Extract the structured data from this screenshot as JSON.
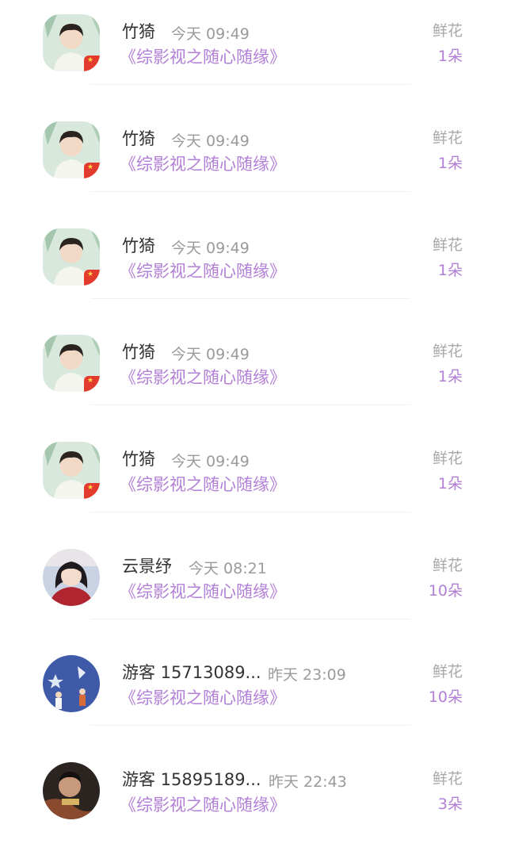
{
  "records": [
    {
      "name": "竹猗",
      "time": "今天 09:49",
      "book": "《综影视之随心随缘》",
      "label": "鲜花",
      "amount": "1朵",
      "avatar": "portrait-boy-icon"
    },
    {
      "name": "竹猗",
      "time": "今天 09:49",
      "book": "《综影视之随心随缘》",
      "label": "鲜花",
      "amount": "1朵",
      "avatar": "portrait-boy-icon"
    },
    {
      "name": "竹猗",
      "time": "今天 09:49",
      "book": "《综影视之随心随缘》",
      "label": "鲜花",
      "amount": "1朵",
      "avatar": "portrait-boy-icon"
    },
    {
      "name": "竹猗",
      "time": "今天 09:49",
      "book": "《综影视之随心随缘》",
      "label": "鲜花",
      "amount": "1朵",
      "avatar": "portrait-boy-icon"
    },
    {
      "name": "竹猗",
      "time": "今天 09:49",
      "book": "《综影视之随心随缘》",
      "label": "鲜花",
      "amount": "1朵",
      "avatar": "portrait-boy-icon"
    },
    {
      "name": "云景纾",
      "time": "今天 08:21",
      "book": "《综影视之随心随缘》",
      "label": "鲜花",
      "amount": "10朵",
      "avatar": "portrait-girl-icon"
    },
    {
      "name": "游客 15713089...",
      "time": "昨天 23:09",
      "book": "《综影视之随心随缘》",
      "label": "鲜花",
      "amount": "10朵",
      "avatar": "illustration-stars-icon"
    },
    {
      "name": "游客 15895189...",
      "time": "昨天 22:43",
      "book": "《综影视之随心随缘》",
      "label": "鲜花",
      "amount": "3朵",
      "avatar": "portrait-dark-icon"
    }
  ]
}
